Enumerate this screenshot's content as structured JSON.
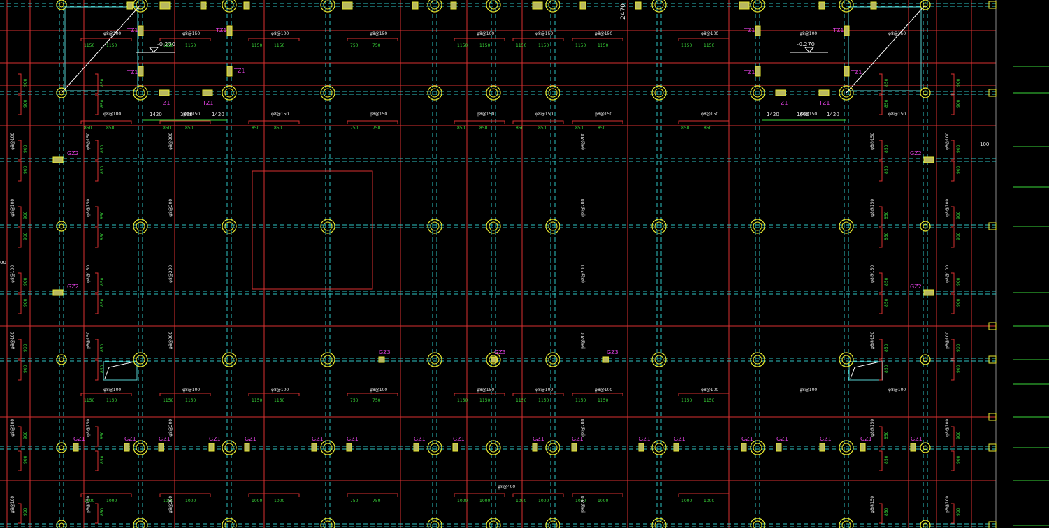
{
  "palette": {
    "background": "#000000",
    "grid_axis": "#2ec4c4",
    "beam_red": "#d83030",
    "column_yellow": "#e8e830",
    "text_green": "#3ad83a",
    "text_white": "#e8e8e8",
    "label_magenta": "#e040e0",
    "outline_cyan": "#59d0d0"
  },
  "elevations": [
    "-0.270",
    "-0.270"
  ],
  "top_dims": {
    "left": [
      "1420",
      "1660",
      "1420"
    ],
    "right": [
      "1420",
      "1660",
      "1420"
    ]
  },
  "rebar_rows": [
    {
      "labels": [
        "φ8@100",
        "φ8@150",
        "φ8@100",
        "φ8@150",
        "φ8@100",
        "φ8@150",
        "φ8@150",
        "φ8@100",
        "φ8@100",
        "φ8@150",
        "φ8@100"
      ]
    },
    {
      "labels": [
        "φ8@100",
        "φ8@150",
        "φ8@150",
        "φ8@150",
        "φ8@150",
        "φ8@150",
        "φ8@150",
        "φ8@150",
        "φ8@150",
        "φ8@150",
        "φ8@150"
      ]
    },
    {
      "labels": [
        "φ8@100",
        "φ8@100",
        "φ8@100",
        "φ8@100",
        "φ8@150",
        "φ8@100",
        "φ8@100",
        "φ8@100",
        "φ8@100",
        "φ8@100",
        "φ8@100"
      ]
    }
  ],
  "spans": {
    "row1": [
      "1150",
      "1150",
      "1150",
      "1150",
      "1150",
      "1150",
      "750",
      "750",
      "1150",
      "1150",
      "1150",
      "1150",
      "1150",
      "1150",
      "1150",
      "1150"
    ],
    "row2": [
      "850",
      "850",
      "850",
      "850",
      "850",
      "850",
      "750",
      "750",
      "850",
      "850",
      "850",
      "850",
      "850",
      "850",
      "850",
      "850"
    ],
    "row3": [
      "1000",
      "1000",
      "1000",
      "1000",
      "1000",
      "1000",
      "750",
      "750",
      "1000",
      "1000",
      "1000",
      "1000",
      "1000",
      "1000",
      "1000",
      "1000"
    ]
  },
  "column_tags": {
    "tz1": "TZ1",
    "gz1": "GZ1",
    "gz2": "GZ2",
    "gz3": "GZ3"
  },
  "misc_labels": {
    "side_dim": "900",
    "side_dim_b": "850",
    "vertical_rebar_a": "φ8@200",
    "vertical_rebar_b": "φ8@150",
    "vertical_rebar_c": "φ8@100",
    "top_mark": "2470",
    "right_mark": "100",
    "left_mark": "00",
    "bottom_rebar": "φ8@400"
  }
}
